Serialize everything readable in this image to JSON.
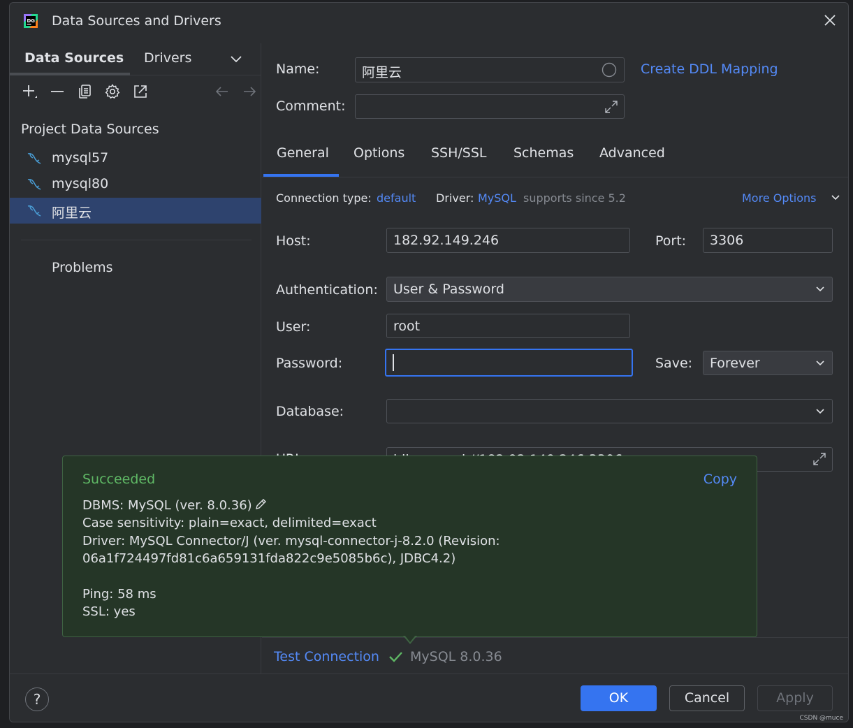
{
  "window": {
    "title": "Data Sources and Drivers"
  },
  "left": {
    "tabs": [
      "Data Sources",
      "Drivers"
    ],
    "section_title": "Project Data Sources",
    "items": [
      "mysql57",
      "mysql80",
      "阿里云"
    ],
    "selected_index": 2,
    "problems_label": "Problems"
  },
  "form": {
    "name_label": "Name:",
    "name_value": "阿里云",
    "create_ddl_link": "Create DDL Mapping",
    "comment_label": "Comment:",
    "comment_value": "",
    "tabs": [
      "General",
      "Options",
      "SSH/SSL",
      "Schemas",
      "Advanced"
    ],
    "active_tab": "General",
    "conn_type_label": "Connection type:",
    "conn_type_value": "default",
    "driver_label": "Driver:",
    "driver_value": "MySQL",
    "driver_note": "supports since 5.2",
    "more_options": "More Options",
    "host_label": "Host:",
    "host_value": "182.92.149.246",
    "port_label": "Port:",
    "port_value": "3306",
    "auth_label": "Authentication:",
    "auth_value": "User & Password",
    "user_label": "User:",
    "user_value": "root",
    "password_label": "Password:",
    "password_value": "",
    "save_label": "Save:",
    "save_value": "Forever",
    "database_label": "Database:",
    "database_value": "",
    "url_label": "URL:",
    "url_value": "jdbc:mysql://182.92.149.246:3306"
  },
  "popup": {
    "title": "Succeeded",
    "copy": "Copy",
    "lines": [
      "DBMS: MySQL (ver. 8.0.36)",
      "Case sensitivity: plain=exact, delimited=exact",
      "Driver: MySQL Connector/J (ver. mysql-connector-j-8.2.0 (Revision:",
      "06a1f724497fd81c6a659131fda822c9e5085b6c), JDBC4.2)",
      "",
      "Ping: 58 ms",
      "SSL: yes"
    ]
  },
  "test": {
    "link": "Test Connection",
    "result": "MySQL 8.0.36"
  },
  "footer": {
    "help": "?",
    "ok": "OK",
    "cancel": "Cancel",
    "apply": "Apply"
  },
  "watermark": "CSDN @muce",
  "colors": {
    "accent": "#3574f0",
    "link": "#548af7",
    "success": "#5fb865",
    "selection": "#2e436e"
  }
}
